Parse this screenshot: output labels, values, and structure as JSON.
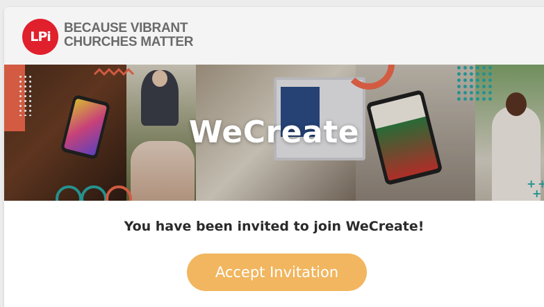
{
  "header": {
    "logo_text": "LPi",
    "tagline_line1": "Because Vibrant",
    "tagline_line2": "Churches Matter"
  },
  "banner": {
    "title": "WeCreate"
  },
  "invite": {
    "message": "You have been invited to join WeCreate!",
    "accept_label": "Accept Invitation"
  },
  "colors": {
    "brand_red": "#e0202c",
    "accent_orange": "#f0684a",
    "button": "#f1b65f",
    "teal": "#2aa7a3"
  }
}
